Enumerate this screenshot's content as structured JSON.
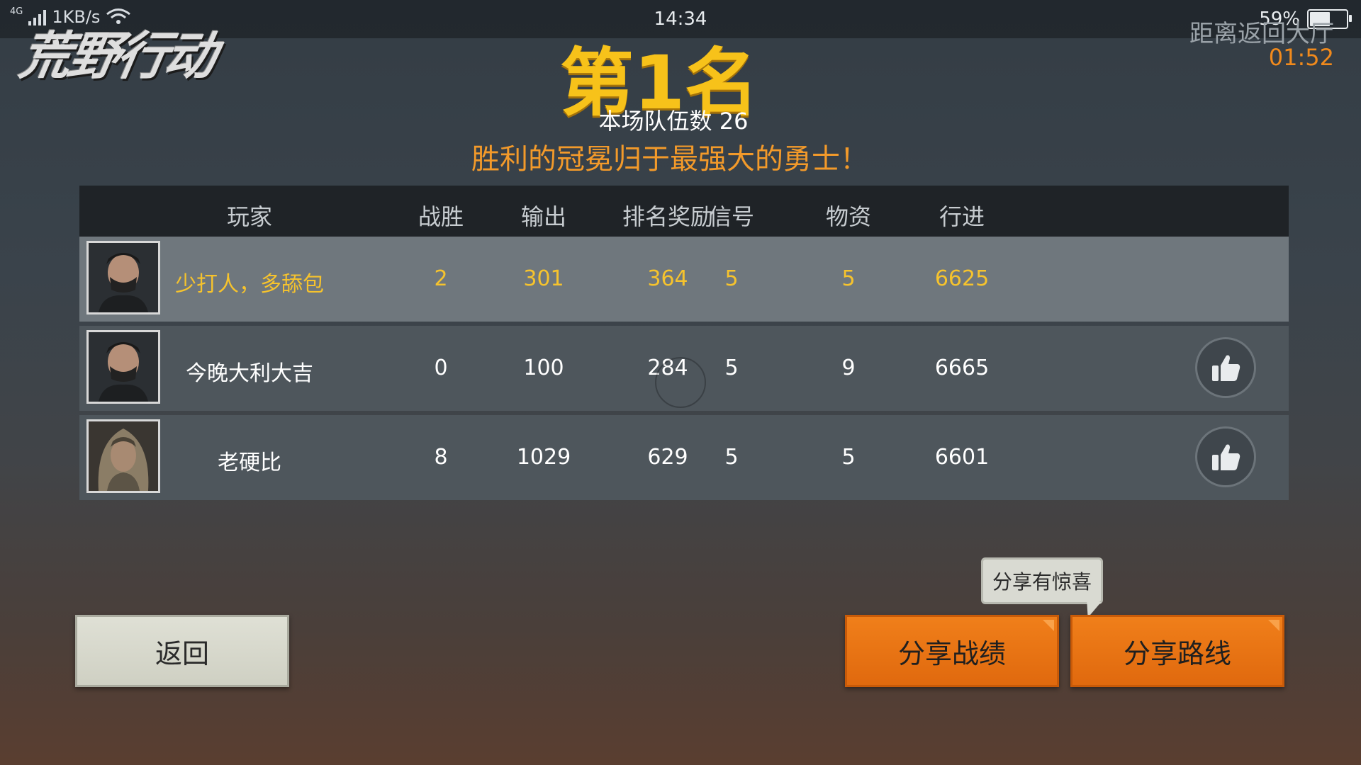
{
  "status_bar": {
    "network": "4G",
    "speed": "1KB/s",
    "time": "14:34",
    "battery": "59%",
    "battery_level": 0.59
  },
  "header": {
    "logo_text": "荒野行动",
    "countdown_label": "距离返回大厅",
    "countdown_time": "01:52",
    "rank_title": "第1名",
    "team_count": "本场队伍数 26",
    "slogan": "胜利的冠冕归于最强大的勇士！"
  },
  "table": {
    "columns": [
      "玩家",
      "战胜",
      "输出",
      "排名奖励",
      "信号",
      "物资",
      "行进"
    ],
    "rows": [
      {
        "player": "少打人，多舔包",
        "wins": "2",
        "damage": "301",
        "rank_reward": "364",
        "signal": "5",
        "supplies": "5",
        "march": "6625",
        "highlight": true
      },
      {
        "player": "今晚大利大吉",
        "wins": "0",
        "damage": "100",
        "rank_reward": "284",
        "signal": "5",
        "supplies": "9",
        "march": "6665",
        "like_icon": "thumbs-up-icon"
      },
      {
        "player": "老硬比",
        "wins": "8",
        "damage": "1029",
        "rank_reward": "629",
        "signal": "5",
        "supplies": "5",
        "march": "6601",
        "like_icon": "thumbs-up-icon"
      }
    ]
  },
  "buttons": {
    "back": "返回",
    "share_stats": "分享战绩",
    "share_route": "分享路线",
    "tooltip": "分享有惊喜"
  },
  "colors": {
    "accent_gold": "#f7c21a",
    "accent_orange": "#f18a1c",
    "button_orange": "#e87414"
  }
}
